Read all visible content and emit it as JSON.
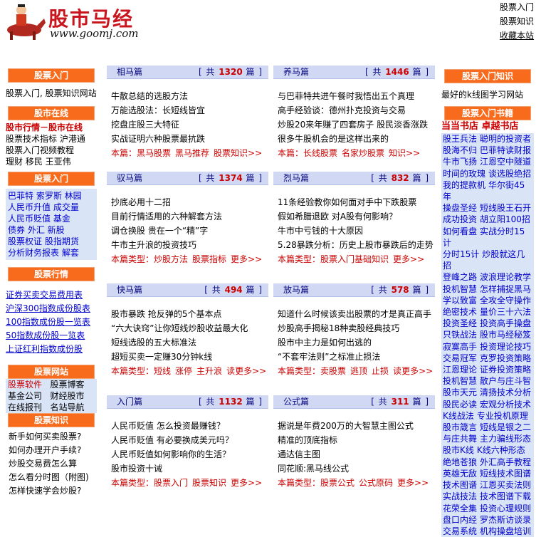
{
  "header": {
    "logo_cn": "股市马经",
    "logo_url": "www.goomj.com",
    "links": [
      "股票入门",
      "股票知识",
      "收藏本站"
    ]
  },
  "left": {
    "sec1_title": "股票入门",
    "sec1_text": "股票入门, 股票知识网站",
    "sec2_title": "股市在线",
    "sec2_red": "股市行情－股市在线",
    "sec2_lines": [
      "股票技术指标 沪港通",
      "股票入门视频教程",
      "理财 移民 王亚伟"
    ],
    "sec3_title": "股票入门",
    "sec3_lines": [
      "巴菲特 索罗斯 林园",
      "人民币升值  成交量",
      "人民币贬值 基金",
      " 债券  外汇  新股",
      "股票权证  股指期货",
      "分析财务报表 解套"
    ],
    "sec4_title": "股票行情",
    "sec4_links": [
      "证券买卖交易费用表",
      "沪深300指数成份股表",
      "100指数成份股一览表",
      "50指数成份股一览表",
      "上证红利指数成份股"
    ],
    "sec5_title": "股票网站",
    "sec5_lines": [
      [
        "股票软件",
        "股票博客"
      ],
      [
        "基金公司",
        "财经股市"
      ],
      [
        "在线报刊",
        "名站导航"
      ]
    ],
    "sec6_title": "股票知识",
    "sec6_lines": [
      "新手如何买卖股票?",
      "如何办理开户手续?",
      "炒股交易费怎么算",
      "怎么看分时图（附图)",
      "怎样快速学会炒股?"
    ]
  },
  "right": {
    "sec1_title": "股票入门知识",
    "sec1_text": "最好的k线图学习网站",
    "sec2_title": "股票入门书籍",
    "sec2_red": "当当书店  卓越书店",
    "books": [
      [
        "股王兵法",
        "聪明的投资者"
      ],
      [
        "股海不归",
        "巴菲特读财报"
      ],
      [
        "牛市飞扬",
        "江恩空中隧道"
      ],
      [
        "时间的玫瑰",
        "谈选股绝招"
      ],
      [
        "我的提款机",
        "华尔街45年"
      ],
      [
        "操盘圣经",
        "短线股王石开"
      ],
      [
        "成功投资",
        "胡立阳100招"
      ],
      [
        "如何看盘",
        "实战分时15计"
      ],
      [
        "分时15计",
        "炒股就这几招"
      ],
      [
        "登峰之路",
        "波浪理论教学"
      ],
      [
        "投机智慧",
        "怎样捕捉黑马"
      ],
      [
        "学以致富",
        "全攻全守操作"
      ],
      [
        "绝密技术",
        "量价三十六法"
      ],
      [
        "投资圣经",
        "投资高手操盘"
      ],
      [
        "只铁战法",
        "股市马经秘笈"
      ],
      [
        "寂寞高手",
        "投资理论技巧"
      ],
      [
        "交易冠军",
        "克罗投资策略"
      ],
      [
        "江恩理论",
        "证券投资策略"
      ],
      [
        "投机智慧",
        "散户与庄斗智"
      ],
      [
        "股市天元",
        "清扬技术分析"
      ],
      [
        "股民必读",
        "宏观分析技术"
      ],
      [
        "K线战法",
        "专业投机原理"
      ],
      [
        "股市箴言",
        "短线是银之二"
      ],
      [
        "与庄共舞",
        "主力骗线形态"
      ],
      [
        "股市K线",
        "K线六种形态"
      ],
      [
        "绝地苍狼",
        "外汇高手教程"
      ],
      [
        "英雄无敌",
        "短线技术图谱"
      ],
      [
        "技术图谱",
        "江恩买卖法则"
      ],
      [
        "实战技法",
        "技术图谱下载"
      ],
      [
        "花荣全集",
        "投资心理规则"
      ],
      [
        "盘口内经",
        "罗杰斯访谈录"
      ],
      [
        "交易系统",
        "机构操盘培训"
      ]
    ]
  },
  "cards": [
    {
      "name": "相马篇",
      "count": "1320",
      "items": [
        "牛散总结的选股方法",
        "万能选股法：长短线皆宜",
        "挖盘庄股三大特征",
        "实战证明六种股票最抗跌"
      ],
      "foot_label": "本篇：",
      "foot_links": [
        "黑马股票",
        "黑马推荐",
        "股票知识>>"
      ]
    },
    {
      "name": "养马篇",
      "count": "1446",
      "items": [
        "与巴菲特共进午餐时我悟出五个真理",
        "高手经验谈：德州扑克投资与交易",
        "炒股20来年赚了四套房子 股民淡香涨跌",
        "很多牛股机会的是这样出来的"
      ],
      "foot_label": "本篇：",
      "foot_links": [
        "长线股票",
        "名家炒股票",
        "知识>>"
      ]
    },
    {
      "name": "驭马篇",
      "count": "1374",
      "items": [
        "抄底必用十二招",
        "目前行情适用的六种解套方法",
        "调仓换股 贵在一个“精”字",
        "牛市主升浪的投资技巧"
      ],
      "foot_label": "本篇类型：",
      "foot_links": [
        "炒股方法",
        "股票指标",
        "更多>>"
      ]
    },
    {
      "name": "烈马篇",
      "count": "832",
      "items": [
        "11条经验教你如何面对手中下跌股票",
        "假如希腊退欧 对A股有何影响？",
        "牛市中亏钱的十大原因",
        "5.28暴跌分析：历史上股市暴跌后的走势"
      ],
      "foot_label": "本篇类型：",
      "foot_links": [
        "股票入门基础知识",
        "更多>>"
      ]
    },
    {
      "name": "快马篇",
      "count": "494",
      "items": [
        "股市暴跌 抢反弹的5个基本点",
        "“六大诀窍”让你短线炒股收益最大化",
        "短线选股的五大标准法",
        "超短买卖一定赚30分钟k线"
      ],
      "foot_label": "本篇类型：",
      "foot_links": [
        "短线",
        "涨停",
        "主升浪",
        "读更多>>"
      ]
    },
    {
      "name": "放马篇",
      "count": "578",
      "items": [
        "知道什么时候该卖出股票的才是真正高手",
        "炒股高手揭秘18种卖股经典技巧",
        "股市中主力是如何出逃的",
        "“不套牢法则”之标准止损法"
      ],
      "foot_label": "本篇类型：",
      "foot_links": [
        "卖股票",
        "逃顶",
        "止损",
        "读更多>>"
      ]
    },
    {
      "name": "入门篇",
      "count": "1132",
      "items": [
        "人民币贬值 怎么投资最赚钱？",
        "人民币贬值 有必要换成美元吗？",
        "人民币贬值如何影响你的生活？",
        "股市投资十诫"
      ],
      "foot_label": "本篇类型：",
      "foot_links": [
        "股票入门",
        "股票知识",
        "更多>>"
      ]
    },
    {
      "name": "公式篇",
      "count": "311",
      "items": [
        "据说是年费200万的大智慧主图公式",
        "精准的顶底指标",
        "通达信主图",
        "同花顺:黑马线公式"
      ],
      "foot_label": "本篇类型：",
      "foot_links": [
        "股票公式",
        "公式原码",
        "更多>>"
      ]
    }
  ],
  "count_prefix": "[ 共",
  "count_suffix": "篇 ]"
}
